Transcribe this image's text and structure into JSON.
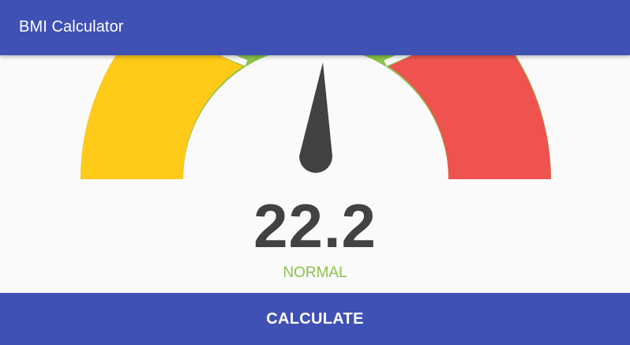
{
  "app_bar": {
    "title": "BMI Calculator"
  },
  "result": {
    "bmi": "22.2",
    "category": "NORMAL"
  },
  "actions": {
    "calculate_label": "CALCULATE"
  },
  "colors": {
    "primary": "#3f51b5",
    "underweight": "#ffca18",
    "normal": "#8bc34a",
    "overweight": "#ef5350",
    "needle": "#424242",
    "value_text": "#424242",
    "category_text": "#8bc34a"
  },
  "icons": {
    "needle": "gauge-needle-icon"
  }
}
